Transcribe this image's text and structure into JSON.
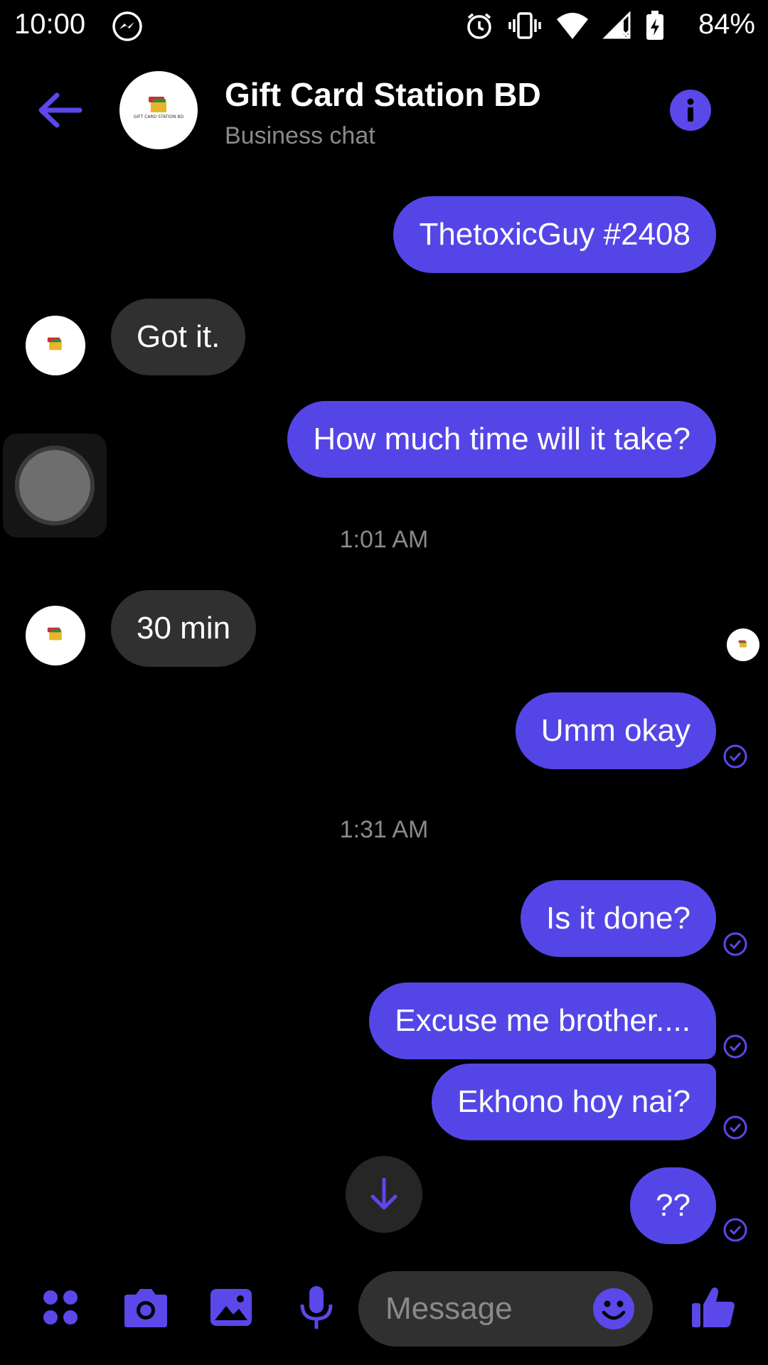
{
  "status_bar": {
    "time": "10:00",
    "battery": "84%",
    "icons": [
      "messenger-icon",
      "alarm-icon",
      "vibrate-icon",
      "wifi-icon",
      "signal-icon",
      "battery-charging-icon"
    ]
  },
  "header": {
    "title": "Gift Card Station BD",
    "subtitle": "Business chat",
    "avatar_text": "GIFT CARD STATION BD"
  },
  "messages": [
    {
      "side": "out",
      "text": "ThetoxicGuy #2408"
    },
    {
      "side": "in",
      "text": "Got it."
    },
    {
      "side": "out",
      "text": "How much time will it take?"
    },
    {
      "timestamp": "1:01 AM"
    },
    {
      "side": "in",
      "text": "30 min"
    },
    {
      "side": "out",
      "text": "Umm okay"
    },
    {
      "timestamp": "1:31 AM"
    },
    {
      "side": "out",
      "text": "Is it done?"
    },
    {
      "side": "out",
      "text": "Excuse me brother...."
    },
    {
      "side": "out",
      "text": "Ekhono hoy nai?"
    },
    {
      "side": "out",
      "text": "??"
    }
  ],
  "composer": {
    "placeholder": "Message"
  },
  "colors": {
    "accent": "#5446e6",
    "incoming_bubble": "#303030",
    "background": "#000000"
  }
}
